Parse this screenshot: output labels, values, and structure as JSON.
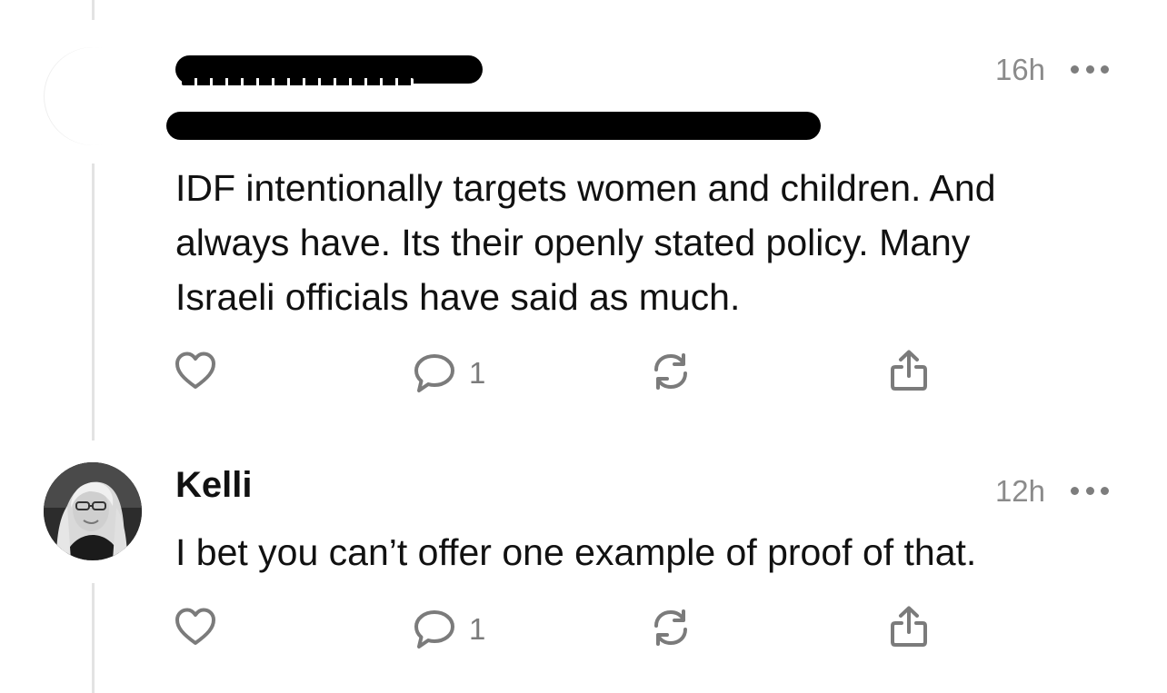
{
  "posts": [
    {
      "author": "",
      "time": "16h",
      "text": "IDF intentionally targets women and children. And\nalways have. Its their openly stated policy. Many\nIsraeli officials have said as much.",
      "reply_count": "1"
    },
    {
      "author": "Kelli",
      "time": "12h",
      "text": "I bet you can’t offer one example of proof of that.",
      "reply_count": "1"
    }
  ],
  "icons": {
    "like": "heart-icon",
    "reply": "comment-icon",
    "repost": "repost-icon",
    "share": "share-icon",
    "more": "more-icon"
  },
  "colors": {
    "text": "#111111",
    "muted": "#8b8b8b",
    "icon": "#7b7b7b",
    "thread_line": "#e3e3e3",
    "redaction": "#000000"
  }
}
